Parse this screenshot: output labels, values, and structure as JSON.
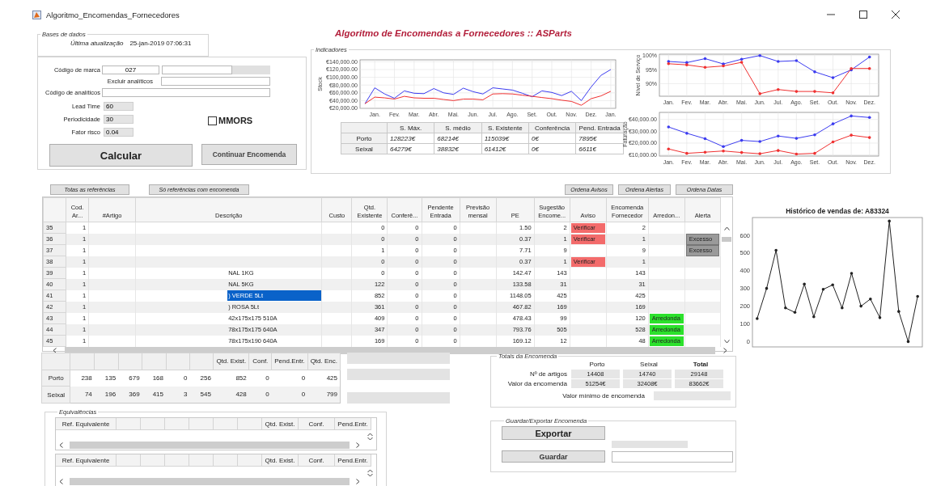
{
  "window": {
    "title": "Algoritmo_Encomendas_Fornecedores"
  },
  "app_title": "Algoritmo de Encomendas a Fornecedores :: ASParts",
  "bases_de_dados": {
    "legend": "Bases de dados",
    "label": "Última atualização",
    "value": "25-jan-2019 07:06:31"
  },
  "form": {
    "codigo_marca": {
      "label": "Código de marca",
      "value": "027"
    },
    "excluir_analiticos": {
      "label": "Excluir analíticos"
    },
    "codigo_analiticos": {
      "label": "Código de analíticos"
    },
    "params": [
      {
        "label": "Lead Time",
        "value": "60"
      },
      {
        "label": "Periodicidade",
        "value": "30"
      },
      {
        "label": "Fator risco",
        "value": "0.04"
      }
    ],
    "mmors": {
      "label": "MMORS",
      "checked": false
    },
    "buttons": [
      "Calcular",
      "Continuar Encomenda"
    ]
  },
  "indicadores": {
    "legend": "Indicadores",
    "stock_chart": {
      "chart_data": {
        "type": "line",
        "grid": true,
        "ylabel": "Stock",
        "categories": [
          null,
          "Jan.",
          null,
          "Fev.",
          null,
          "Mar.",
          null,
          "Abr.",
          null,
          "Mai.",
          null,
          "Jun.",
          null,
          "Jul.",
          null,
          "Ago.",
          null,
          "Set.",
          null,
          "Out.",
          null,
          "Nov.",
          null,
          "Dez.",
          null,
          "Jan."
        ],
        "ylim": [
          20000,
          145000
        ],
        "yticks": [
          {
            "value": 20000,
            "label": "€20,000.00"
          },
          {
            "value": 40000,
            "label": "€40,000.00"
          },
          {
            "value": 60000,
            "label": "€60,000.00"
          },
          {
            "value": 80000,
            "label": "€80,000.00"
          },
          {
            "value": 100000,
            "label": "€100,000.00"
          },
          {
            "value": 120000,
            "label": "€120,000.00"
          },
          {
            "value": 140000,
            "label": "€140,000.00"
          }
        ],
        "series": [
          {
            "color": "#3b3bf0",
            "values": [
              32000,
              73000,
              57000,
              46000,
              65000,
              59000,
              58000,
              71000,
              60000,
              56000,
              72000,
              63000,
              57000,
              73000,
              70000,
              67000,
              59000,
              50000,
              65000,
              61000,
              53000,
              64000,
              40000,
              75000,
              105000,
              120000
            ]
          },
          {
            "color": "#f03030",
            "values": [
              32000,
              49000,
              47000,
              44000,
              51000,
              47000,
              46000,
              46000,
              43000,
              40000,
              44000,
              44000,
              42000,
              57000,
              58000,
              57000,
              54000,
              51000,
              48000,
              45000,
              41000,
              38000,
              28000,
              45000,
              52000,
              64000
            ]
          }
        ]
      }
    },
    "table": {
      "columns": [
        "S. Máx.",
        "S. médio",
        "S. Existente",
        "Conferência",
        "Pend. Entrada"
      ],
      "rows": [
        {
          "label": "Porto",
          "values": [
            "128223€",
            "68214€",
            "115039€",
            "0€",
            "7895€"
          ]
        },
        {
          "label": "Seixal",
          "values": [
            "64279€",
            "38832€",
            "61412€",
            "0€",
            "6611€"
          ]
        }
      ]
    },
    "service_chart": {
      "chart_data": {
        "type": "line",
        "grid": true,
        "ylabel": "Nível de Serviço",
        "categories": [
          "Jan.",
          "Fev.",
          "Mar.",
          "Abr.",
          "Mai.",
          "Jun.",
          "Jul.",
          "Ago.",
          "Set.",
          "Out.",
          "Nov.",
          "Dez."
        ],
        "ylim": [
          85.5,
          100.5
        ],
        "yticks": [
          {
            "value": 90,
            "label": "90%"
          },
          {
            "value": 95,
            "label": "95%"
          },
          {
            "value": 100,
            "label": "100%"
          }
        ],
        "series": [
          {
            "color": "#3b3bf0",
            "values": [
              97.9,
              97.5,
              98.9,
              97,
              98.7,
              100,
              97.9,
              98.2,
              94.2,
              92.1,
              94.9,
              99.5
            ]
          },
          {
            "color": "#f03030",
            "values": [
              97.1,
              96.7,
              95.8,
              96.3,
              97.6,
              86.4,
              87.9,
              87.2,
              87.2,
              86.7,
              95.4,
              95.4
            ]
          }
        ]
      }
    },
    "billing_chart": {
      "chart_data": {
        "type": "line",
        "grid": true,
        "ylabel": "Faturação",
        "categories": [
          "Jan.",
          "Fev.",
          "Mar.",
          "Abr.",
          "Mai.",
          "Jun.",
          "Jul.",
          "Ago.",
          "Set.",
          "Out.",
          "Nov.",
          "Dez."
        ],
        "ylim": [
          9000,
          46000
        ],
        "yticks": [
          {
            "value": 10000,
            "label": "€10,000.00"
          },
          {
            "value": 20000,
            "label": "€20,000.00"
          },
          {
            "value": 30000,
            "label": "€30,000.00"
          },
          {
            "value": 40000,
            "label": "€40,000.00"
          }
        ],
        "series": [
          {
            "color": "#3b3bf0",
            "values": [
              33700,
              28300,
              23700,
              17000,
              22300,
              21300,
              26000,
              24000,
              27000,
              36300,
              43000,
              41700
            ]
          },
          {
            "color": "#f03030",
            "values": [
              15000,
              11300,
              12300,
              13300,
              12000,
              11000,
              13700,
              10700,
              11300,
              21000,
              26700,
              24700
            ]
          }
        ]
      }
    }
  },
  "list_buttons": [
    "Totas as referências",
    "Só referências com encomenda"
  ],
  "sort_buttons": [
    "Ordena Avisos",
    "Ordena Alertas",
    "Ordena Datas"
  ],
  "table": {
    "columns": [
      "Cod. Ar...",
      "#Artigo",
      "Descrição",
      "Custo",
      "Qtd. Existente",
      "Conferê...",
      "Pendente Entrada",
      "Previsão mensal",
      "PE",
      "Sugestão Encome...",
      "Aviso",
      "Encomenda Fornecedor",
      "Arredon...",
      "Alerta"
    ],
    "rows": [
      {
        "row": "35",
        "cod": "1",
        "qtd": "0",
        "conf": "0",
        "pend": "0",
        "pe": "1.50",
        "sug": "2",
        "aviso": "Verificar",
        "enc": "2",
        "selected": false
      },
      {
        "row": "36",
        "cod": "1",
        "qtd": "0",
        "conf": "0",
        "pend": "0",
        "pe": "0.37",
        "sug": "1",
        "aviso": "Verificar",
        "enc": "1",
        "alerta": "Excesso",
        "selected": false
      },
      {
        "row": "37",
        "cod": "1",
        "qtd": "1",
        "conf": "0",
        "pend": "0",
        "pe": "7.71",
        "sug": "9",
        "enc": "9",
        "alerta": "Excesso",
        "selected": false
      },
      {
        "row": "38",
        "cod": "1",
        "qtd": "0",
        "conf": "0",
        "pend": "0",
        "pe": "0.37",
        "sug": "1",
        "aviso": "Verificar",
        "enc": "1",
        "selected": false
      },
      {
        "row": "39",
        "cod": "1",
        "desc": "NAL 1KG",
        "qtd": "0",
        "conf": "0",
        "pend": "0",
        "pe": "142.47",
        "sug": "143",
        "enc": "143",
        "selected": false
      },
      {
        "row": "40",
        "cod": "1",
        "desc": "NAL 5KG",
        "qtd": "122",
        "conf": "0",
        "pend": "0",
        "pe": "133.58",
        "sug": "31",
        "enc": "31",
        "selected": false
      },
      {
        "row": "41",
        "cod": "1",
        "desc": ") VERDE 5Lt",
        "qtd": "852",
        "conf": "0",
        "pend": "0",
        "pe": "1148.05",
        "sug": "425",
        "enc": "425",
        "selected": true
      },
      {
        "row": "42",
        "cod": "1",
        "desc": ")  ROSA 5Lt",
        "qtd": "361",
        "conf": "0",
        "pend": "0",
        "pe": "467.82",
        "sug": "169",
        "enc": "169",
        "selected": false
      },
      {
        "row": "43",
        "cod": "1",
        "desc": "42x175x175 510A",
        "qtd": "409",
        "conf": "0",
        "pend": "0",
        "pe": "478.43",
        "sug": "99",
        "enc": "120",
        "arred": "Arredonda",
        "selected": false
      },
      {
        "row": "44",
        "cod": "1",
        "desc": "78x175x175 640A",
        "qtd": "347",
        "conf": "0",
        "pend": "0",
        "pe": "793.76",
        "sug": "505",
        "enc": "528",
        "arred": "Arredonda",
        "selected": false
      },
      {
        "row": "45",
        "cod": "1",
        "desc": "78x175x190 640A",
        "qtd": "169",
        "conf": "0",
        "pend": "0",
        "pe": "169.12",
        "sug": "12",
        "enc": "48",
        "arred": "Arredonda",
        "selected": false
      }
    ]
  },
  "history_chart": {
    "chart_data": {
      "type": "line",
      "title": "Histórico de vendas de: A83324",
      "categories": [
        null,
        null,
        null,
        null,
        null,
        null,
        null,
        null,
        null,
        null,
        null,
        null,
        null,
        null,
        null,
        null,
        null,
        null
      ],
      "ylim": [
        -30,
        700
      ],
      "yticks": [
        0,
        100,
        200,
        300,
        400,
        500,
        600
      ],
      "series": [
        {
          "color": "#222222",
          "values": [
            130,
            300,
            515,
            190,
            165,
            325,
            140,
            295,
            320,
            190,
            385,
            200,
            240,
            135,
            680,
            170,
            0,
            255
          ]
        }
      ]
    }
  },
  "summary": {
    "columns": [
      "Qtd. Exist.",
      "Conf.",
      "Pend.Entr.",
      "Qtd. Enc."
    ],
    "rows": [
      {
        "label": "Porto",
        "values": [
          "238",
          "135",
          "679",
          "168",
          "0",
          "256",
          "852",
          "0",
          "0",
          "425"
        ]
      },
      {
        "label": "Seixal",
        "values": [
          "74",
          "196",
          "369",
          "415",
          "3",
          "545",
          "428",
          "0",
          "0",
          "799"
        ]
      }
    ]
  },
  "equivalencias": {
    "legend": "Equivalências",
    "tables": [
      {
        "columns": [
          "Ref. Equivalente",
          "Qtd. Exist.",
          "Conf.",
          "Pend.Entr."
        ]
      },
      {
        "columns": [
          "Ref. Equivalente",
          "Qtd. Exist.",
          "Conf.",
          "Pend.Entr."
        ]
      }
    ]
  },
  "totais": {
    "legend": "Totais da Encomenda",
    "columns": [
      "Porto",
      "Seixal",
      "Total"
    ],
    "rows": [
      {
        "label": "Nº de artigos",
        "values": [
          "14408",
          "14740",
          "29148"
        ]
      },
      {
        "label": "Valor da encomenda",
        "values": [
          "51254€",
          "32408€",
          "83662€"
        ]
      }
    ],
    "minimum": {
      "label": "Valor mínimo de encomenda"
    }
  },
  "guardar": {
    "legend": "Guardar/Exportar Encomenda",
    "buttons": [
      "Exportar",
      "Guardar"
    ]
  }
}
